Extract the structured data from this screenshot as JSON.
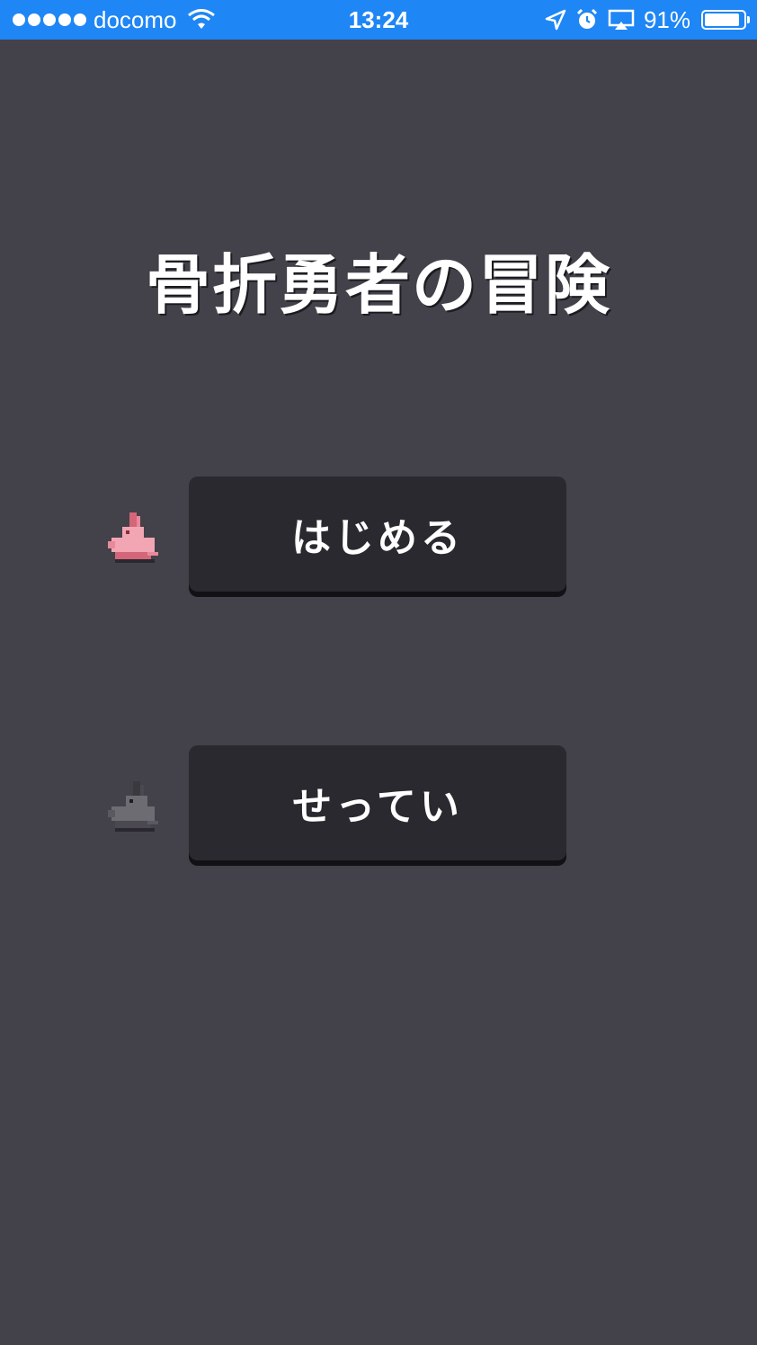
{
  "status_bar": {
    "carrier": "docomo",
    "time": "13:24",
    "battery_percent": "91%",
    "battery_level": 0.91,
    "signal_bars": 5,
    "icons": [
      "signal-dots-icon",
      "wifi-icon",
      "location-arrow-icon",
      "alarm-icon",
      "airplay-icon",
      "battery-icon"
    ],
    "background_color": "#1f86f5"
  },
  "main": {
    "title": "骨折勇者の冒険",
    "background_color": "#434149",
    "menu": {
      "start_label": "はじめる",
      "settings_label": "せってい",
      "start_marker_icon": "pink-rabbit-icon",
      "settings_marker_icon": "gray-rabbit-icon"
    }
  }
}
